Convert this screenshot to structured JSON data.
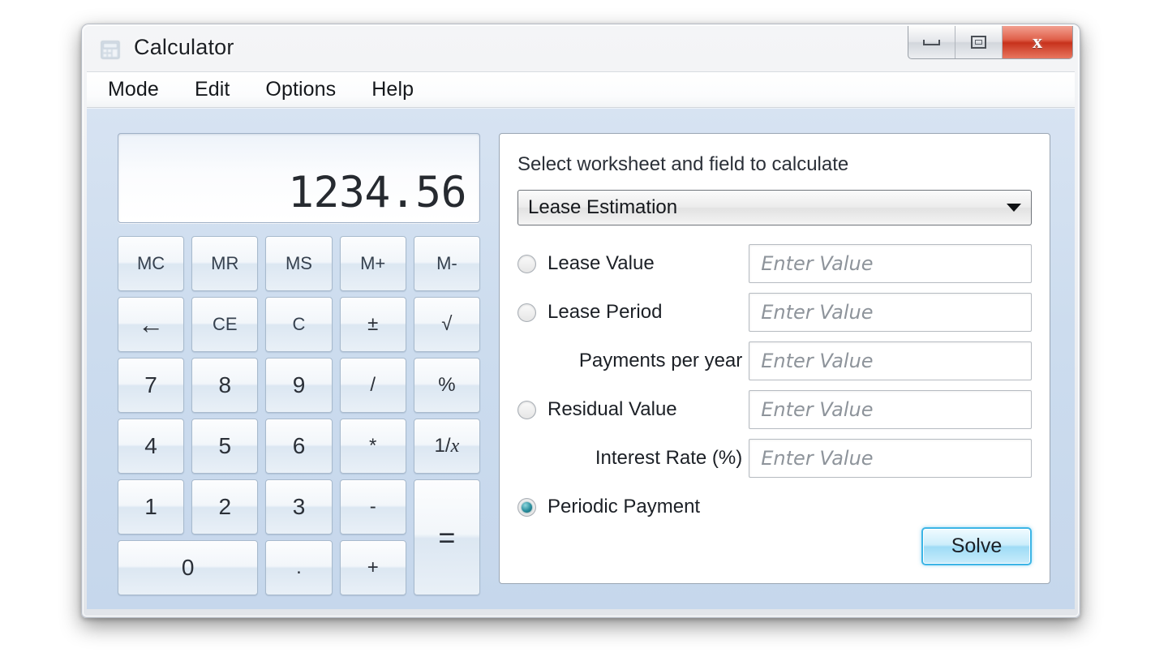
{
  "window": {
    "title": "Calculator",
    "icon": "calculator-icon",
    "controls": [
      {
        "name": "minimize-button",
        "glyph": "minimize-icon"
      },
      {
        "name": "maximize-button",
        "glyph": "maximize-icon"
      },
      {
        "name": "close-button",
        "glyph": "close-icon",
        "label": "x",
        "color": "#c7321c"
      }
    ]
  },
  "menubar": {
    "items": [
      {
        "label": "Mode"
      },
      {
        "label": "Edit"
      },
      {
        "label": "Options"
      },
      {
        "label": "Help"
      }
    ]
  },
  "calculator": {
    "display_value": "1234.56",
    "keys": [
      {
        "label": "MC",
        "name": "memory-clear-button",
        "class": "mem"
      },
      {
        "label": "MR",
        "name": "memory-recall-button",
        "class": "mem"
      },
      {
        "label": "MS",
        "name": "memory-store-button",
        "class": "mem"
      },
      {
        "label": "M+",
        "name": "memory-add-button",
        "class": "mem"
      },
      {
        "label": "M-",
        "name": "memory-subtract-button",
        "class": "mem"
      },
      {
        "label": "←",
        "name": "backspace-button",
        "class": "back"
      },
      {
        "label": "CE",
        "name": "clear-entry-button",
        "class": "mem"
      },
      {
        "label": "C",
        "name": "clear-button",
        "class": "mem"
      },
      {
        "label": "±",
        "name": "sign-toggle-button",
        "class": "small"
      },
      {
        "label": "√",
        "name": "square-root-button",
        "class": "small"
      },
      {
        "label": "7",
        "name": "digit-7-button",
        "class": ""
      },
      {
        "label": "8",
        "name": "digit-8-button",
        "class": ""
      },
      {
        "label": "9",
        "name": "digit-9-button",
        "class": ""
      },
      {
        "label": "/",
        "name": "divide-button",
        "class": "small"
      },
      {
        "label": "%",
        "name": "percent-button",
        "class": "small"
      },
      {
        "label": "4",
        "name": "digit-4-button",
        "class": ""
      },
      {
        "label": "5",
        "name": "digit-5-button",
        "class": ""
      },
      {
        "label": "6",
        "name": "digit-6-button",
        "class": ""
      },
      {
        "label": "*",
        "name": "multiply-button",
        "class": "small"
      },
      {
        "label": "1/x",
        "name": "reciprocal-button",
        "class": "small"
      },
      {
        "label": "1",
        "name": "digit-1-button",
        "class": ""
      },
      {
        "label": "2",
        "name": "digit-2-button",
        "class": ""
      },
      {
        "label": "3",
        "name": "digit-3-button",
        "class": ""
      },
      {
        "label": "-",
        "name": "subtract-button",
        "class": "small"
      },
      {
        "label": "=",
        "name": "equals-button",
        "class": "tall2"
      },
      {
        "label": "0",
        "name": "digit-0-button",
        "class": "wide2"
      },
      {
        "label": ".",
        "name": "decimal-point-button",
        "class": "small"
      },
      {
        "label": "+",
        "name": "add-button",
        "class": "small"
      }
    ]
  },
  "worksheet": {
    "title": "Select worksheet and field to calculate",
    "selected": "Lease Estimation",
    "placeholder": "Enter Value",
    "fields": [
      {
        "label": "Lease Value",
        "radio": true,
        "selected": false,
        "indent": false,
        "input": true
      },
      {
        "label": "Lease Period",
        "radio": true,
        "selected": false,
        "indent": false,
        "input": true
      },
      {
        "label": "Payments per year",
        "radio": false,
        "selected": false,
        "indent": true,
        "input": true
      },
      {
        "label": "Residual Value",
        "radio": true,
        "selected": false,
        "indent": false,
        "input": true
      },
      {
        "label": "Interest Rate (%)",
        "radio": false,
        "selected": false,
        "indent": true,
        "input": true
      },
      {
        "label": "Periodic Payment",
        "radio": true,
        "selected": true,
        "indent": false,
        "input": false
      }
    ],
    "solve_label": "Solve"
  }
}
